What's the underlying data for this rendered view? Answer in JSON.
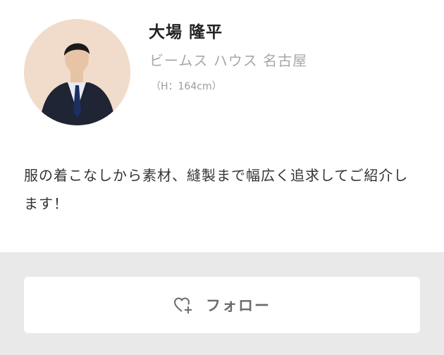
{
  "profile": {
    "name": "大場 隆平",
    "shop": "ビームス ハウス 名古屋",
    "height": "（H：164cm）",
    "bio": "服の着こなしから素材、縫製まで幅広く追求してご紹介します！",
    "avatar_alt": "staff-photo"
  },
  "actions": {
    "follow_label": "フォロー",
    "follow_icon": "heart-plus-icon"
  },
  "colors": {
    "name_text": "#222222",
    "shop_text": "#a8a8a8",
    "height_text": "#9a9a9a",
    "bio_text": "#333333",
    "action_bg": "#e9e9e9",
    "button_bg": "#ffffff",
    "button_text": "#6b6b6b",
    "avatar_bg": "#f1dccb"
  }
}
